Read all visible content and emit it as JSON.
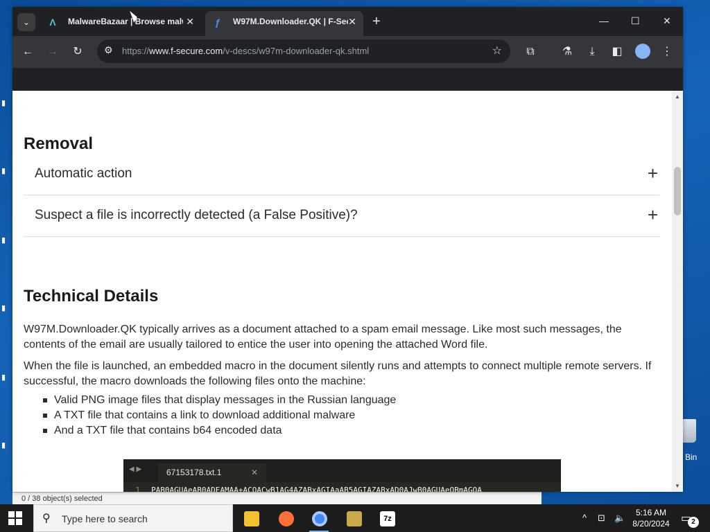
{
  "browser": {
    "tabs": [
      {
        "title": "MalwareBazaar | Browse malw",
        "favicon": "malwarebazaar-icon",
        "active": false
      },
      {
        "title": "W97M.Downloader.QK | F-Secu",
        "favicon": "f-secure-icon",
        "active": true
      }
    ],
    "new_tab": "+",
    "url": {
      "scheme": "https://",
      "host": "www.f-secure.com",
      "path": "/v-descs/w97m-downloader-qk.shtml"
    }
  },
  "page": {
    "removal_heading": "Removal",
    "accordion": [
      {
        "label": "Automatic action"
      },
      {
        "label": "Suspect a file is incorrectly detected (a False Positive)?"
      }
    ],
    "tech_heading": "Technical Details",
    "paragraph1": "W97M.Downloader.QK typically arrives as a document attached to a spam email message. Like most such messages, the contents of the email are usually tailored to entice the user into opening the attached Word file.",
    "paragraph2": "When the file is launched, an embedded macro in the document silently runs and attempts to connect multiple remote servers. If successful, the macro downloads the following files onto the machine:",
    "bullets": [
      "Valid PNG image files that display messages in the Russian language",
      "A TXT file that contains a link to download additional malware",
      "And a TXT file that contains b64 encoded data"
    ],
    "editor": {
      "tab_name": "67153178.txt.1",
      "line_number": "1",
      "line_text": "PAB0AGUAeAB0ADEAMAA+ACQACwB1AG4AZABxAGIAaAB5AGIAZABxAD0AJwB0AGUAeQBmAGQA"
    }
  },
  "explorer_status": "0 / 38 object(s) selected",
  "desktop": {
    "recycle_label": "Bin"
  },
  "taskbar": {
    "search_placeholder": "Type here to search",
    "time": "5:16 AM",
    "date": "8/20/2024",
    "notification_count": "2"
  }
}
